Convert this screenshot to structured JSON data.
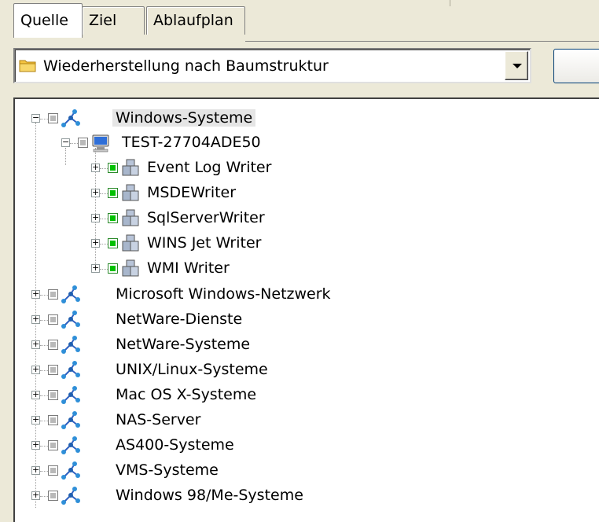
{
  "tabs": [
    {
      "label": "Quelle",
      "active": true
    },
    {
      "label": "Ziel",
      "active": false
    },
    {
      "label": "Ablaufplan",
      "active": false
    }
  ],
  "view_select": {
    "value": "Wiederherstellung nach Baumstruktur",
    "icon": "folder-icon"
  },
  "tree": {
    "root": {
      "label": "Windows-Systeme",
      "expanded": true,
      "selected": true,
      "icon": "network-icon"
    },
    "computer": {
      "label": "TEST-27704ADE50",
      "expanded": true,
      "icon": "computer-icon"
    },
    "writers": [
      {
        "label": "Event Log Writer",
        "icon": "writer-icon"
      },
      {
        "label": "MSDEWriter",
        "icon": "writer-icon"
      },
      {
        "label": "SqlServerWriter",
        "icon": "writer-icon"
      },
      {
        "label": "WINS Jet Writer",
        "icon": "writer-icon"
      },
      {
        "label": "WMI Writer",
        "icon": "writer-icon"
      }
    ],
    "nodes": [
      {
        "label": "Microsoft Windows-Netzwerk",
        "icon": "network-icon"
      },
      {
        "label": "NetWare-Dienste",
        "icon": "network-icon"
      },
      {
        "label": "NetWare-Systeme",
        "icon": "network-icon"
      },
      {
        "label": "UNIX/Linux-Systeme",
        "icon": "network-icon"
      },
      {
        "label": "Mac OS X-Systeme",
        "icon": "network-icon"
      },
      {
        "label": "NAS-Server",
        "icon": "network-icon"
      },
      {
        "label": "AS400-Systeme",
        "icon": "network-icon"
      },
      {
        "label": "VMS-Systeme",
        "icon": "network-icon"
      },
      {
        "label": "Windows 98/Me-Systeme",
        "icon": "network-icon"
      }
    ]
  },
  "colors": {
    "window_bg": "#ece9d8",
    "selection": "#e5e5e5",
    "check_green": "#00c000"
  }
}
